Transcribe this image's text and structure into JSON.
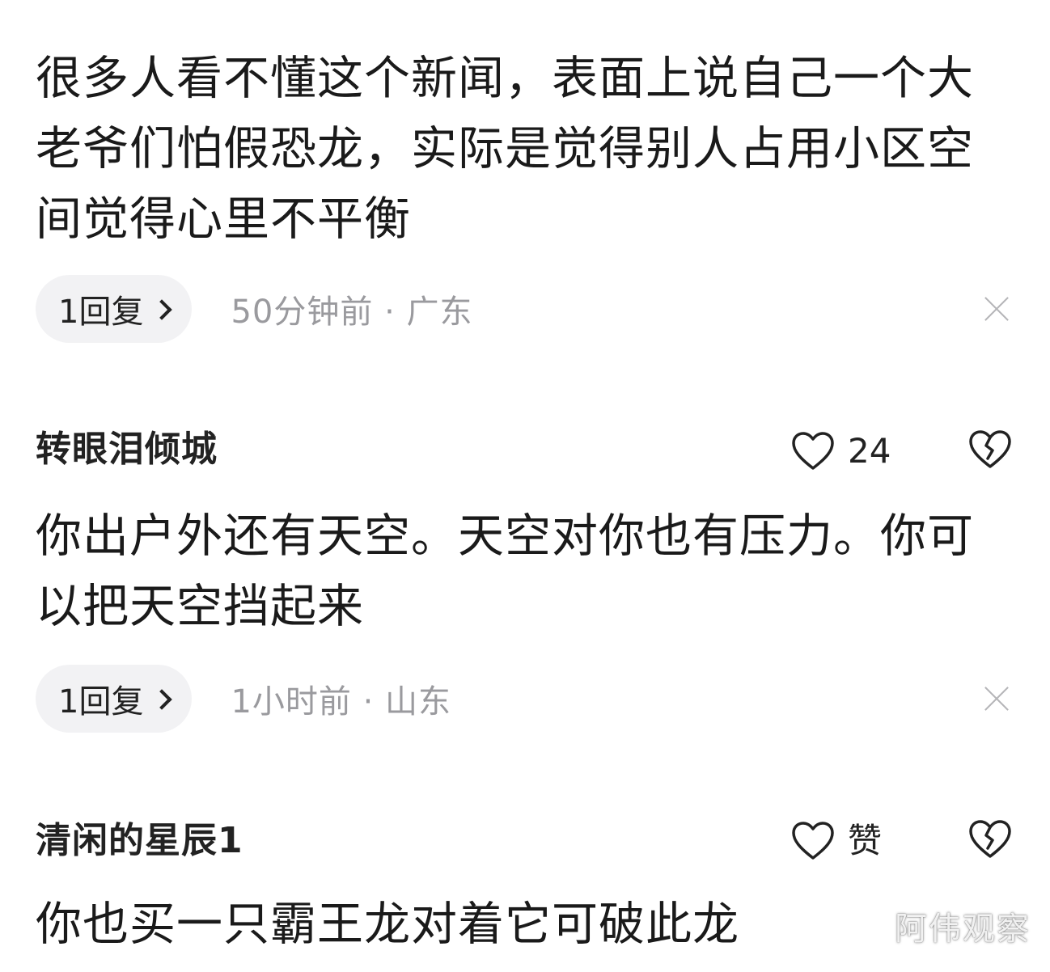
{
  "comments": [
    {
      "author": "",
      "likes": "",
      "text": "很多人看不懂这个新闻，表面上说自己一个大老爷们怕假恐龙，实际是觉得别人占用小区空间觉得心里不平衡",
      "replies": "1回复",
      "time_location": "50分钟前 · 广东"
    },
    {
      "author": "转眼泪倾城",
      "likes": "24",
      "text": "你出户外还有天空。天空对你也有压力。你可以把天空挡起来",
      "replies": "1回复",
      "time_location": "1小时前 · 山东"
    },
    {
      "author": "清闲的星辰1",
      "likes": "赞",
      "text": "你也买一只霸王龙对着它可破此龙",
      "replies": "",
      "time_location": ""
    }
  ],
  "watermark": "阿伟观察",
  "icons": {
    "like": "heart-outline-icon",
    "dislike": "broken-heart-icon",
    "close": "close-icon",
    "reply_chevron": "chevron-right-icon"
  },
  "colors": {
    "reply_pill_bg": "#f2f2f4",
    "meta_text": "#9a9a9e"
  }
}
